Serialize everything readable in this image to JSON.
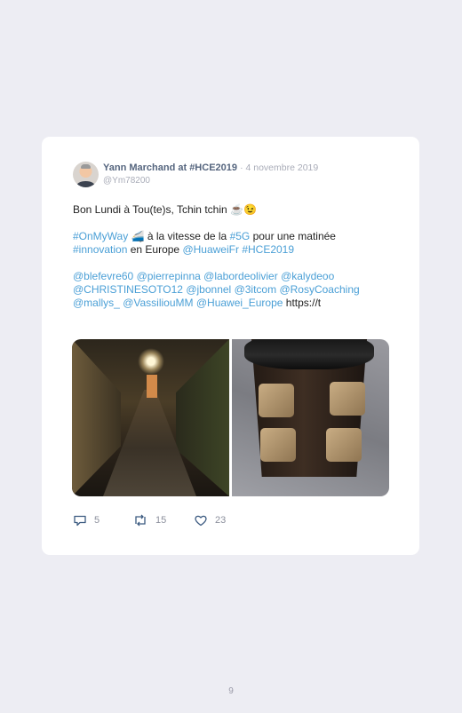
{
  "tweet": {
    "author": "Yann Marchand at #HCE2019",
    "date": "· 4 novembre 2019",
    "handle": "@Ym78200",
    "line1": "Bon Lundi à Tou(te)s, Tchin tchin ☕😉",
    "para2": [
      {
        "text": "#OnMyWay",
        "link": true
      },
      {
        "text": " 🚄 à la vitesse de la ",
        "link": false
      },
      {
        "text": "#5G",
        "link": true
      },
      {
        "text": " pour une matinée ",
        "link": false
      },
      {
        "text": "#innovation",
        "link": true
      },
      {
        "text": " en Europe ",
        "link": false
      },
      {
        "text": "@HuaweiFr",
        "link": true
      },
      {
        "text": " ",
        "link": false
      },
      {
        "text": "#HCE2019",
        "link": true
      }
    ],
    "para3": [
      {
        "text": "@blefevre60",
        "link": true
      },
      {
        "text": " ",
        "link": false
      },
      {
        "text": "@pierrepinna",
        "link": true
      },
      {
        "text": " ",
        "link": false
      },
      {
        "text": "@labordeolivier",
        "link": true
      },
      {
        "text": " ",
        "link": false
      },
      {
        "text": "@kalydeoo",
        "link": true
      },
      {
        "text": " ",
        "link": false
      },
      {
        "text": "@CHRISTINESOTO12",
        "link": true
      },
      {
        "text": " ",
        "link": false
      },
      {
        "text": "@jbonnel",
        "link": true
      },
      {
        "text": " ",
        "link": false
      },
      {
        "text": "@3itcom",
        "link": true
      },
      {
        "text": " ",
        "link": false
      },
      {
        "text": "@RosyCoaching",
        "link": true
      },
      {
        "text": " ",
        "link": false
      },
      {
        "text": "@mallys_",
        "link": true
      },
      {
        "text": " ",
        "link": false
      },
      {
        "text": "@VassiliouMM",
        "link": true
      },
      {
        "text": " ",
        "link": false
      },
      {
        "text": "@Huawei_Europe",
        "link": true
      },
      {
        "text": " https://t",
        "link": false
      }
    ],
    "media": [
      "alley-photo",
      "coffee-cup-photo"
    ],
    "actions": {
      "replies": "5",
      "retweets": "15",
      "likes": "23"
    }
  },
  "icons": {
    "reply": "reply-icon",
    "retweet": "retweet-icon",
    "like": "heart-icon"
  },
  "colors": {
    "background": "#ededf3",
    "card": "#ffffff",
    "link": "#4a9fd6",
    "author": "#55657e",
    "muted": "#a9acb8"
  },
  "page": {
    "number": "9"
  }
}
